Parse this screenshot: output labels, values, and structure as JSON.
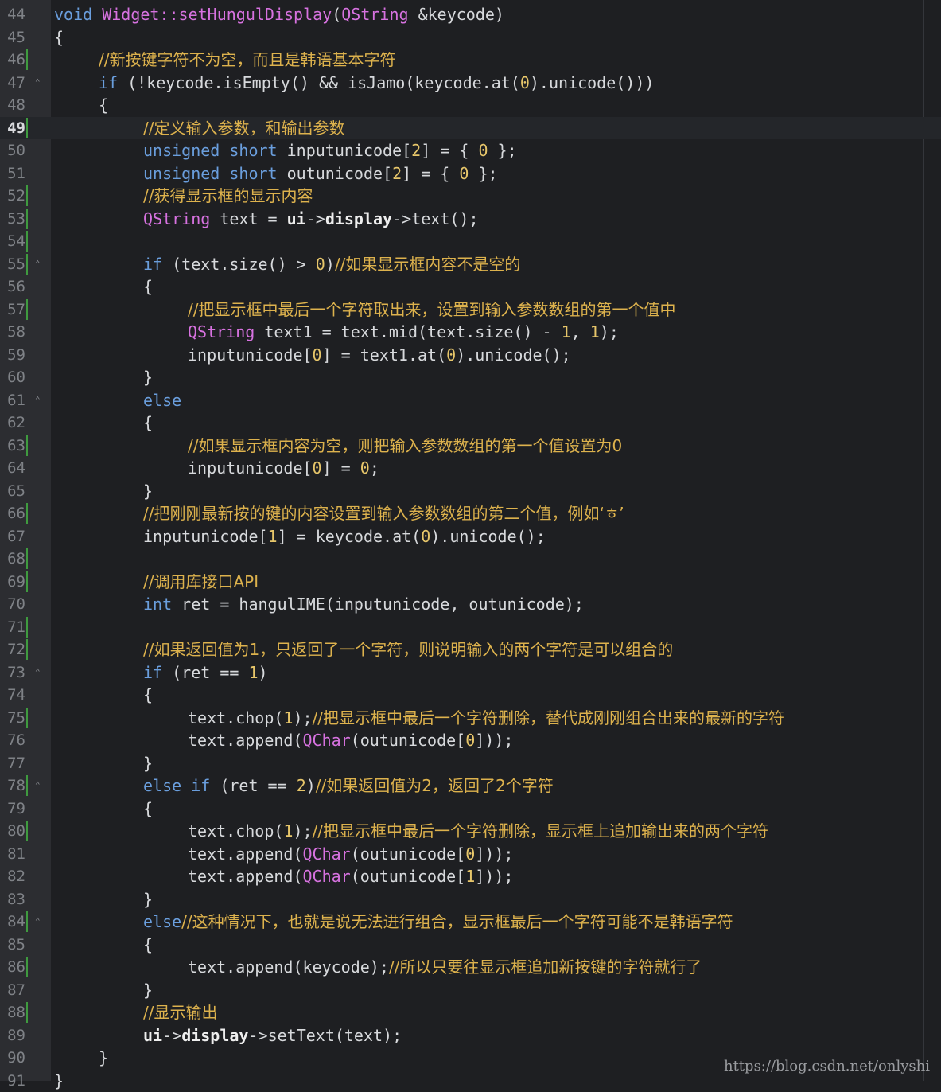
{
  "editor": {
    "current_line": 49,
    "watermark": "https://blog.csdn.net/onlyshi",
    "colors": {
      "background": "#1e1f22",
      "gutter": "#2c2d31",
      "keyword": "#6a9edd",
      "type": "#d772e0",
      "comment": "#ddb24d",
      "number": "#e7c66a",
      "change_marker": "#3f9a3f"
    }
  },
  "lines": [
    {
      "n": 44,
      "indent": 0,
      "tokens": [
        {
          "t": "void",
          "c": "kw"
        },
        {
          "t": " "
        },
        {
          "t": "Widget::setHungulDisplay",
          "c": "ty"
        },
        {
          "t": "("
        },
        {
          "t": "QString",
          "c": "ty"
        },
        {
          "t": " &keycode)"
        }
      ]
    },
    {
      "n": 45,
      "indent": 0,
      "tokens": [
        {
          "t": "{"
        }
      ]
    },
    {
      "n": 46,
      "indent": 1,
      "mark": true,
      "tokens": [
        {
          "t": "//新按键字符不为空，而且是韩语基本字符",
          "c": "cm"
        }
      ]
    },
    {
      "n": 47,
      "indent": 1,
      "fold": true,
      "tokens": [
        {
          "t": "if",
          "c": "kw"
        },
        {
          "t": " (!keycode.isEmpty() && isJamo(keycode.at("
        },
        {
          "t": "0",
          "c": "num"
        },
        {
          "t": ").unicode()))"
        }
      ]
    },
    {
      "n": 48,
      "indent": 1,
      "tokens": [
        {
          "t": "{"
        }
      ]
    },
    {
      "n": 49,
      "indent": 2,
      "mark": true,
      "current": true,
      "tokens": [
        {
          "t": "//定义输入参数，和输出参数",
          "c": "cm"
        }
      ]
    },
    {
      "n": 50,
      "indent": 2,
      "tokens": [
        {
          "t": "unsigned",
          "c": "kw"
        },
        {
          "t": " "
        },
        {
          "t": "short",
          "c": "kw"
        },
        {
          "t": " inputunicode["
        },
        {
          "t": "2",
          "c": "num"
        },
        {
          "t": "] = { "
        },
        {
          "t": "0",
          "c": "num"
        },
        {
          "t": " };"
        }
      ]
    },
    {
      "n": 51,
      "indent": 2,
      "tokens": [
        {
          "t": "unsigned",
          "c": "kw"
        },
        {
          "t": " "
        },
        {
          "t": "short",
          "c": "kw"
        },
        {
          "t": " outunicode["
        },
        {
          "t": "2",
          "c": "num"
        },
        {
          "t": "] = { "
        },
        {
          "t": "0",
          "c": "num"
        },
        {
          "t": " };"
        }
      ]
    },
    {
      "n": 52,
      "indent": 2,
      "mark": true,
      "tokens": [
        {
          "t": "//获得显示框的显示内容",
          "c": "cm"
        }
      ]
    },
    {
      "n": 53,
      "indent": 2,
      "mark": true,
      "tokens": [
        {
          "t": "QString",
          "c": "ty"
        },
        {
          "t": " text = "
        },
        {
          "t": "ui",
          "c": "bold"
        },
        {
          "t": "->"
        },
        {
          "t": "display",
          "c": "bold"
        },
        {
          "t": "->text();"
        }
      ]
    },
    {
      "n": 54,
      "indent": 0,
      "mark": true,
      "tokens": []
    },
    {
      "n": 55,
      "indent": 2,
      "mark": true,
      "fold": true,
      "tokens": [
        {
          "t": "if",
          "c": "kw"
        },
        {
          "t": " (text.size() > "
        },
        {
          "t": "0",
          "c": "num"
        },
        {
          "t": ")"
        },
        {
          "t": "//如果显示框内容不是空的",
          "c": "cm"
        }
      ]
    },
    {
      "n": 56,
      "indent": 2,
      "tokens": [
        {
          "t": "{"
        }
      ]
    },
    {
      "n": 57,
      "indent": 3,
      "mark": true,
      "tokens": [
        {
          "t": "//把显示框中最后一个字符取出来，设置到输入参数数组的第一个值中",
          "c": "cm"
        }
      ]
    },
    {
      "n": 58,
      "indent": 3,
      "tokens": [
        {
          "t": "QString",
          "c": "ty"
        },
        {
          "t": " text1 = text.mid(text.size() - "
        },
        {
          "t": "1",
          "c": "num"
        },
        {
          "t": ", "
        },
        {
          "t": "1",
          "c": "num"
        },
        {
          "t": ");"
        }
      ]
    },
    {
      "n": 59,
      "indent": 3,
      "tokens": [
        {
          "t": "inputunicode["
        },
        {
          "t": "0",
          "c": "num"
        },
        {
          "t": "] = text1.at("
        },
        {
          "t": "0",
          "c": "num"
        },
        {
          "t": ").unicode();"
        }
      ]
    },
    {
      "n": 60,
      "indent": 2,
      "tokens": [
        {
          "t": "}"
        }
      ]
    },
    {
      "n": 61,
      "indent": 2,
      "fold": true,
      "tokens": [
        {
          "t": "else",
          "c": "kw"
        }
      ]
    },
    {
      "n": 62,
      "indent": 2,
      "tokens": [
        {
          "t": "{"
        }
      ]
    },
    {
      "n": 63,
      "indent": 3,
      "mark": true,
      "tokens": [
        {
          "t": "//如果显示框内容为空，则把输入参数数组的第一个值设置为0",
          "c": "cm"
        }
      ]
    },
    {
      "n": 64,
      "indent": 3,
      "tokens": [
        {
          "t": "inputunicode["
        },
        {
          "t": "0",
          "c": "num"
        },
        {
          "t": "] = "
        },
        {
          "t": "0",
          "c": "num"
        },
        {
          "t": ";"
        }
      ]
    },
    {
      "n": 65,
      "indent": 2,
      "tokens": [
        {
          "t": "}"
        }
      ]
    },
    {
      "n": 66,
      "indent": 2,
      "mark": true,
      "tokens": [
        {
          "t": "//把刚刚最新按的键的内容设置到输入参数数组的第二个值，例如‘ㅎ’",
          "c": "cm"
        }
      ]
    },
    {
      "n": 67,
      "indent": 2,
      "tokens": [
        {
          "t": "inputunicode["
        },
        {
          "t": "1",
          "c": "num"
        },
        {
          "t": "] = keycode.at("
        },
        {
          "t": "0",
          "c": "num"
        },
        {
          "t": ").unicode();"
        }
      ]
    },
    {
      "n": 68,
      "indent": 0,
      "mark": true,
      "tokens": []
    },
    {
      "n": 69,
      "indent": 2,
      "mark": true,
      "tokens": [
        {
          "t": "//调用库接口API",
          "c": "cm"
        }
      ]
    },
    {
      "n": 70,
      "indent": 2,
      "tokens": [
        {
          "t": "int",
          "c": "kw"
        },
        {
          "t": " ret = hangulIME(inputunicode, outunicode);"
        }
      ]
    },
    {
      "n": 71,
      "indent": 0,
      "mark": true,
      "tokens": []
    },
    {
      "n": 72,
      "indent": 2,
      "mark": true,
      "tokens": [
        {
          "t": "//如果返回值为1，只返回了一个字符，则说明输入的两个字符是可以组合的",
          "c": "cm"
        }
      ]
    },
    {
      "n": 73,
      "indent": 2,
      "fold": true,
      "tokens": [
        {
          "t": "if",
          "c": "kw"
        },
        {
          "t": " (ret == "
        },
        {
          "t": "1",
          "c": "num"
        },
        {
          "t": ")"
        }
      ]
    },
    {
      "n": 74,
      "indent": 2,
      "tokens": [
        {
          "t": "{"
        }
      ]
    },
    {
      "n": 75,
      "indent": 3,
      "mark": true,
      "tokens": [
        {
          "t": "text.chop("
        },
        {
          "t": "1",
          "c": "num"
        },
        {
          "t": ");"
        },
        {
          "t": "//把显示框中最后一个字符删除，替代成刚刚组合出来的最新的字符",
          "c": "cm"
        }
      ]
    },
    {
      "n": 76,
      "indent": 3,
      "tokens": [
        {
          "t": "text.append("
        },
        {
          "t": "QChar",
          "c": "ty"
        },
        {
          "t": "(outunicode["
        },
        {
          "t": "0",
          "c": "num"
        },
        {
          "t": "]));"
        }
      ]
    },
    {
      "n": 77,
      "indent": 2,
      "tokens": [
        {
          "t": "}"
        }
      ]
    },
    {
      "n": 78,
      "indent": 2,
      "mark": true,
      "fold": true,
      "tokens": [
        {
          "t": "else",
          "c": "kw"
        },
        {
          "t": " "
        },
        {
          "t": "if",
          "c": "kw"
        },
        {
          "t": " (ret == "
        },
        {
          "t": "2",
          "c": "num"
        },
        {
          "t": ")"
        },
        {
          "t": "//如果返回值为2，返回了2个字符",
          "c": "cm"
        }
      ]
    },
    {
      "n": 79,
      "indent": 2,
      "tokens": [
        {
          "t": "{"
        }
      ]
    },
    {
      "n": 80,
      "indent": 3,
      "mark": true,
      "tokens": [
        {
          "t": "text.chop("
        },
        {
          "t": "1",
          "c": "num"
        },
        {
          "t": ");"
        },
        {
          "t": "//把显示框中最后一个字符删除，显示框上追加输出来的两个字符",
          "c": "cm"
        }
      ]
    },
    {
      "n": 81,
      "indent": 3,
      "tokens": [
        {
          "t": "text.append("
        },
        {
          "t": "QChar",
          "c": "ty"
        },
        {
          "t": "(outunicode["
        },
        {
          "t": "0",
          "c": "num"
        },
        {
          "t": "]));"
        }
      ]
    },
    {
      "n": 82,
      "indent": 3,
      "tokens": [
        {
          "t": "text.append("
        },
        {
          "t": "QChar",
          "c": "ty"
        },
        {
          "t": "(outunicode["
        },
        {
          "t": "1",
          "c": "num"
        },
        {
          "t": "]));"
        }
      ]
    },
    {
      "n": 83,
      "indent": 2,
      "tokens": [
        {
          "t": "}"
        }
      ]
    },
    {
      "n": 84,
      "indent": 2,
      "mark": true,
      "fold": true,
      "tokens": [
        {
          "t": "else",
          "c": "kw"
        },
        {
          "t": "//这种情况下，也就是说无法进行组合，显示框最后一个字符可能不是韩语字符",
          "c": "cm"
        }
      ]
    },
    {
      "n": 85,
      "indent": 2,
      "tokens": [
        {
          "t": "{"
        }
      ]
    },
    {
      "n": 86,
      "indent": 3,
      "mark": true,
      "tokens": [
        {
          "t": "text.append(keycode);"
        },
        {
          "t": "//所以只要往显示框追加新按键的字符就行了",
          "c": "cm"
        }
      ]
    },
    {
      "n": 87,
      "indent": 2,
      "tokens": [
        {
          "t": "}"
        }
      ]
    },
    {
      "n": 88,
      "indent": 2,
      "mark": true,
      "tokens": [
        {
          "t": "//显示输出",
          "c": "cm"
        }
      ]
    },
    {
      "n": 89,
      "indent": 2,
      "tokens": [
        {
          "t": "ui",
          "c": "bold"
        },
        {
          "t": "->"
        },
        {
          "t": "display",
          "c": "bold"
        },
        {
          "t": "->setText(text);"
        }
      ]
    },
    {
      "n": 90,
      "indent": 1,
      "tokens": [
        {
          "t": "}"
        }
      ]
    },
    {
      "n": 91,
      "indent": 0,
      "tokens": [
        {
          "t": "}"
        }
      ]
    }
  ]
}
